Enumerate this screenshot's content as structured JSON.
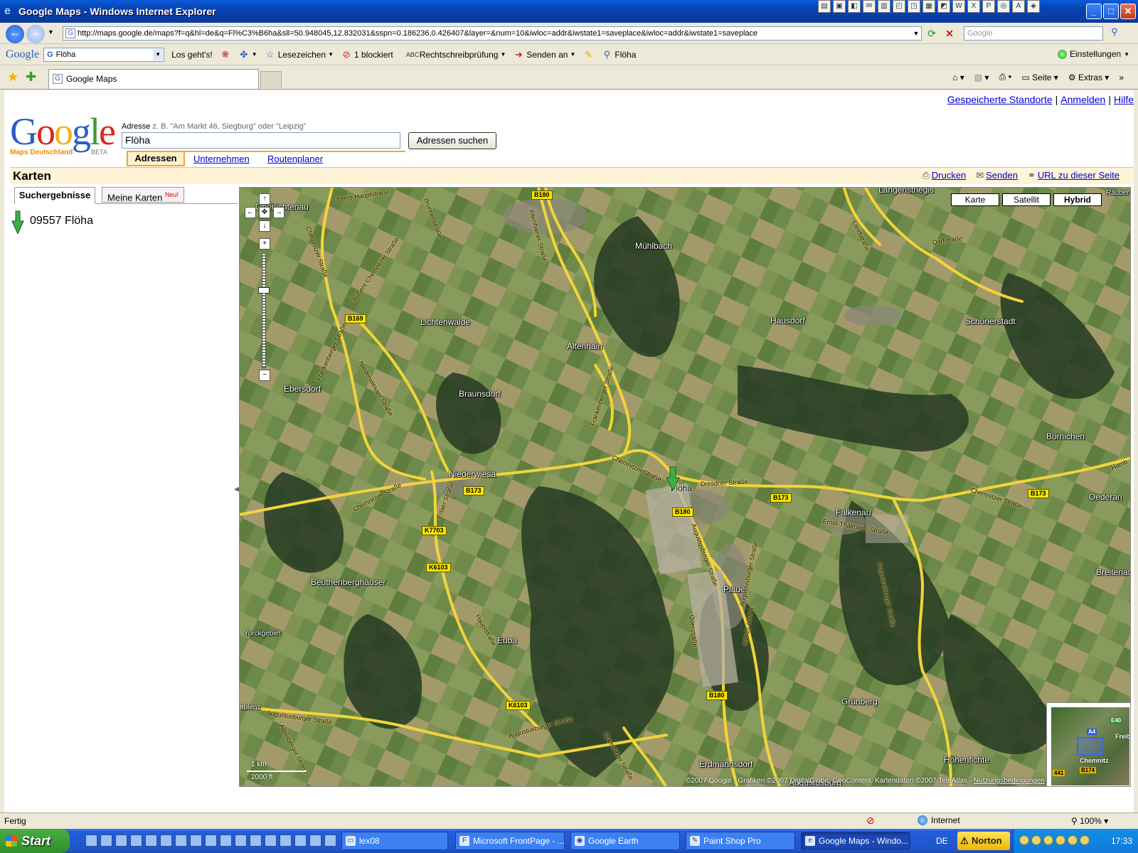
{
  "window": {
    "title": "Google Maps - Windows Internet Explorer",
    "app_icon": "ie-icon"
  },
  "addressbar": {
    "url": "http://maps.google.de/maps?f=q&hl=de&q=Fl%C3%B6ha&sll=50.948045,12.832031&sspn=0.186236,0.426407&layer=&num=10&iwloc=addr&iwstate1=saveplace&iwloc=addr&iwstate1=saveplace",
    "search_placeholder": "Google"
  },
  "google_toolbar": {
    "logo": "Google",
    "query": "Flöha",
    "go": "Los geht's!",
    "bookmarks": "Lesezeichen",
    "blocked": "1 blockiert",
    "spellcheck": "Rechtschreibprüfung",
    "send": "Senden an",
    "highlight_term": "Flöha",
    "settings": "Einstellungen"
  },
  "tabs": {
    "active_tab": "Google Maps",
    "cmd_page": "Seite",
    "cmd_extras": "Extras"
  },
  "page": {
    "toplinks": [
      "Gespeicherte Standorte",
      "Anmelden",
      "Hilfe"
    ],
    "logo_subtitle": "Maps Deutschland",
    "logo_beta": "BETA",
    "address_label": "Adresse",
    "address_hint": "z. B. \"Am Markt 46, Siegburg\" oder \"Leipzig\"",
    "address_value": "Flöha",
    "submit": "Adressen suchen",
    "search_tabs": [
      "Adressen",
      "Unternehmen",
      "Routenplaner"
    ],
    "section_title": "Karten",
    "actions": [
      "Drucken",
      "Senden",
      "URL zu dieser Seite"
    ]
  },
  "sidebar": {
    "tab_results": "Suchergebnisse",
    "tab_mymaps": "Meine Karten",
    "tab_mymaps_badge": "Neu!",
    "result": "09557 Flöha"
  },
  "map": {
    "types": [
      "Karte",
      "Satellit",
      "Hybrid"
    ],
    "active_type": "Hybrid",
    "places": [
      "Oberlichtenau",
      "Langenstriegis",
      "Mühlbach",
      "Lichtenwalde",
      "Altenhain",
      "Hausdorf",
      "Schönerstadt",
      "Ebersdorf",
      "Braunsdorf",
      "Börnichen",
      "Niederwiesa",
      "Flöha",
      "Falkenau",
      "Oederan",
      "Breitenau",
      "Beuthenberghäuser",
      "Plaue",
      "Yorckgebiet",
      "Euba",
      "Grünberg",
      "Hohenfichte",
      "Erdmannsdorf",
      "Augustusburg",
      "ablenz",
      "Räuber"
    ],
    "streets": [
      "Untere Hauptstraße",
      "Brunnenstraße",
      "Altenhainer Straße",
      "Chemnitzer Straße",
      "Äußere Chemnitzer Straße",
      "Frankenberger Straße",
      "Niederwiesaer Straße",
      "Frankenberger Straße",
      "Chemnitzer Straße",
      "Dresdner Straße",
      "Chemnitzer Straße",
      "Erlaer Straße",
      "Augustusburger Straße",
      "Ernst-Thälmann-Straße",
      "Augustusburger Straße",
      "Augustusburger Straße",
      "Hauptstraße",
      "Augustusburger Straße",
      "Chemnitzer Straße",
      "Landstraße",
      "Dorfstraße",
      "Chemnitzer Straße",
      "Augustusburger Straße",
      "Adelsberger Straße",
      "Querstraße",
      "Lange Straße",
      "Hamb"
    ],
    "shields": [
      "B180",
      "B169",
      "B173",
      "B173",
      "B173",
      "B180",
      "K7703",
      "K6103",
      "K6103",
      "B180"
    ],
    "scale_km": "1 km",
    "scale_ft": "2000 ft",
    "copyright": "©2007 Google - Grafiken ©2007 DigitalGlobe, GeoContent, Kartendaten ©2007 TeleAtlas - ",
    "terms": "Nutzungsbedingungen",
    "overview": {
      "labels": [
        "Chemnitz",
        "Freib"
      ],
      "shields": [
        "E40",
        "A4",
        "B174",
        "441"
      ]
    }
  },
  "statusbar": {
    "text": "Fertig",
    "zone": "Internet",
    "zoom": "100%"
  },
  "taskbar": {
    "start": "Start",
    "items": [
      "lex08",
      "Microsoft FrontPage - ...",
      "Google Earth",
      "Paint Shop Pro",
      "Google Maps - Windo..."
    ],
    "lang": "DE",
    "norton": "Norton",
    "clock": "17:33"
  },
  "colors": {
    "title_bar": "#0842b0",
    "link": "#0000cc",
    "maps_orange": "#f0a830",
    "road_yellow": "#f2d43a",
    "shield_yellow": "#f6e400"
  }
}
